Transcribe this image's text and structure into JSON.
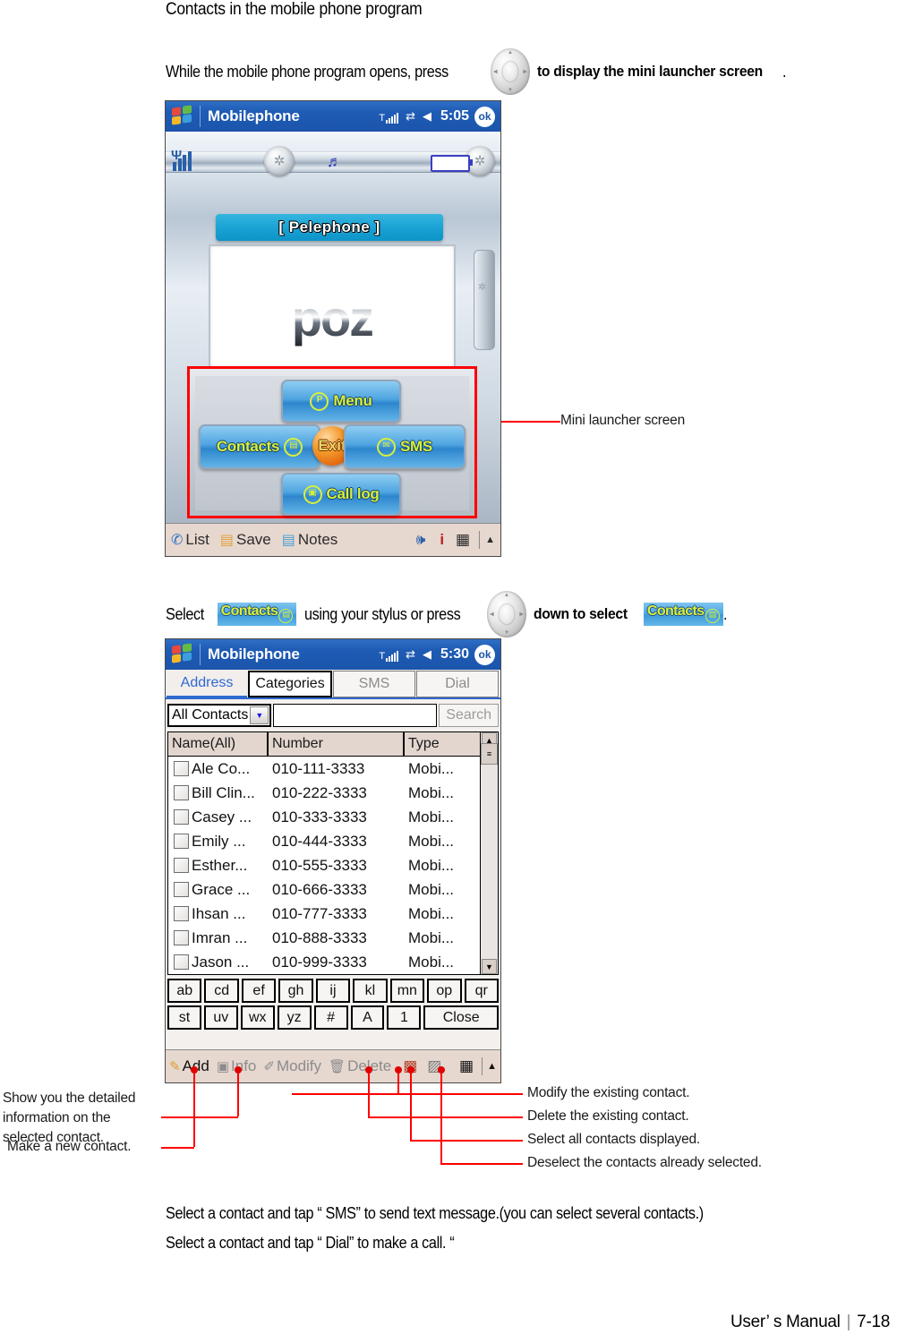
{
  "heading": "Contacts in the mobile phone program",
  "intro": {
    "before": "While the mobile phone program opens, press",
    "after_bold": "to display the mini launcher screen",
    "period": "."
  },
  "select_line": {
    "before": "Select",
    "middle": "using your stylus or press",
    "bold": "down to select",
    "period": ".",
    "chip_label": "Contacts"
  },
  "device1": {
    "titlebar": {
      "app_name": "Mobilephone",
      "time": "5:05",
      "ok_label": "ok",
      "icons": [
        "signal-icon",
        "connectivity-icon",
        "volume-icon"
      ]
    },
    "banner": "[ Pelephone ]",
    "lcd_text": "poz",
    "launcher": {
      "menu": "Menu",
      "contacts": "Contacts",
      "exit": "Exit",
      "sms": "SMS",
      "calllog": "Call log"
    },
    "commandbar": [
      {
        "icon": "phone-icon",
        "label": "List"
      },
      {
        "icon": "save-icon",
        "label": "Save"
      },
      {
        "icon": "notes-icon",
        "label": "Notes"
      }
    ],
    "commandbar_icons": [
      "speaker-icon",
      "info-icon",
      "keyboard-icon",
      "chevron-up-icon"
    ]
  },
  "device2": {
    "titlebar": {
      "app_name": "Mobilephone",
      "time": "5:30",
      "ok_label": "ok"
    },
    "tabs": [
      {
        "label": "Address",
        "state": "selected"
      },
      {
        "label": "Categories",
        "state": "emphasized"
      },
      {
        "label": "SMS",
        "state": "normal"
      },
      {
        "label": "Dial",
        "state": "normal"
      }
    ],
    "filter": {
      "value": "All Contacts"
    },
    "search_input": {
      "value": "",
      "placeholder": ""
    },
    "search_button": "Search",
    "table": {
      "headers": [
        "Name(All)",
        "Number",
        "Type"
      ],
      "rows": [
        {
          "checked": false,
          "name": "Ale Co...",
          "number": "010-111-3333",
          "type": "Mobi..."
        },
        {
          "checked": false,
          "name": "Bill Clin...",
          "number": "010-222-3333",
          "type": "Mobi..."
        },
        {
          "checked": false,
          "name": "Casey ...",
          "number": "010-333-3333",
          "type": "Mobi..."
        },
        {
          "checked": false,
          "name": "Emily ...",
          "number": "010-444-3333",
          "type": "Mobi..."
        },
        {
          "checked": false,
          "name": "Esther...",
          "number": "010-555-3333",
          "type": "Mobi..."
        },
        {
          "checked": false,
          "name": "Grace ...",
          "number": "010-666-3333",
          "type": "Mobi..."
        },
        {
          "checked": false,
          "name": "Ihsan ...",
          "number": "010-777-3333",
          "type": "Mobi..."
        },
        {
          "checked": false,
          "name": "Imran ...",
          "number": "010-888-3333",
          "type": "Mobi..."
        },
        {
          "checked": false,
          "name": "Jason ...",
          "number": "010-999-3333",
          "type": "Mobi..."
        }
      ]
    },
    "keypad_row1": [
      "ab",
      "cd",
      "ef",
      "gh",
      "ij",
      "kl",
      "mn",
      "op",
      "qr"
    ],
    "keypad_row2": [
      "st",
      "uv",
      "wx",
      "yz",
      "#",
      "A",
      "1"
    ],
    "keypad_close": "Close",
    "commandbar": [
      {
        "icon": "pencil-icon",
        "label": "Add"
      },
      {
        "icon": "info-person-icon",
        "label": "Info"
      },
      {
        "icon": "modify-icon",
        "label": "Modify"
      },
      {
        "icon": "trash-icon",
        "label": "Delete"
      }
    ],
    "commandbar_icons": [
      "select-all-icon",
      "deselect-all-icon",
      "keyboard-icon",
      "chevron-up-icon"
    ]
  },
  "callouts": {
    "mini_launcher": "Mini launcher screen",
    "info": "Show you the detailed\ninformation on the\nselected contact.",
    "info_l1": "Show you the detailed",
    "info_l2": "information on the",
    "info_l3": "selected contact.",
    "add": "Make a new contact.",
    "modify": "Modify the existing contact.",
    "delete": "Delete the existing contact.",
    "select_all": "Select all contacts displayed.",
    "deselect": "Deselect the contacts already selected."
  },
  "bottom_notes": {
    "line1": "Select a contact and tap “ SMS”  to send text message.(you can select several contacts.)",
    "line2": "Select a contact and tap “ Dial”  to make a call. “"
  },
  "footer": {
    "manual": "User’ s Manual",
    "separator": "|",
    "page": "7-18"
  },
  "colors": {
    "titlebar_blue": "#1b54ab",
    "callout_red": "#ff0000",
    "tab_active": "#2f6ad0",
    "chip_yellow": "#d9ef3a",
    "cmdbar_bg": "#e6d7cf"
  }
}
